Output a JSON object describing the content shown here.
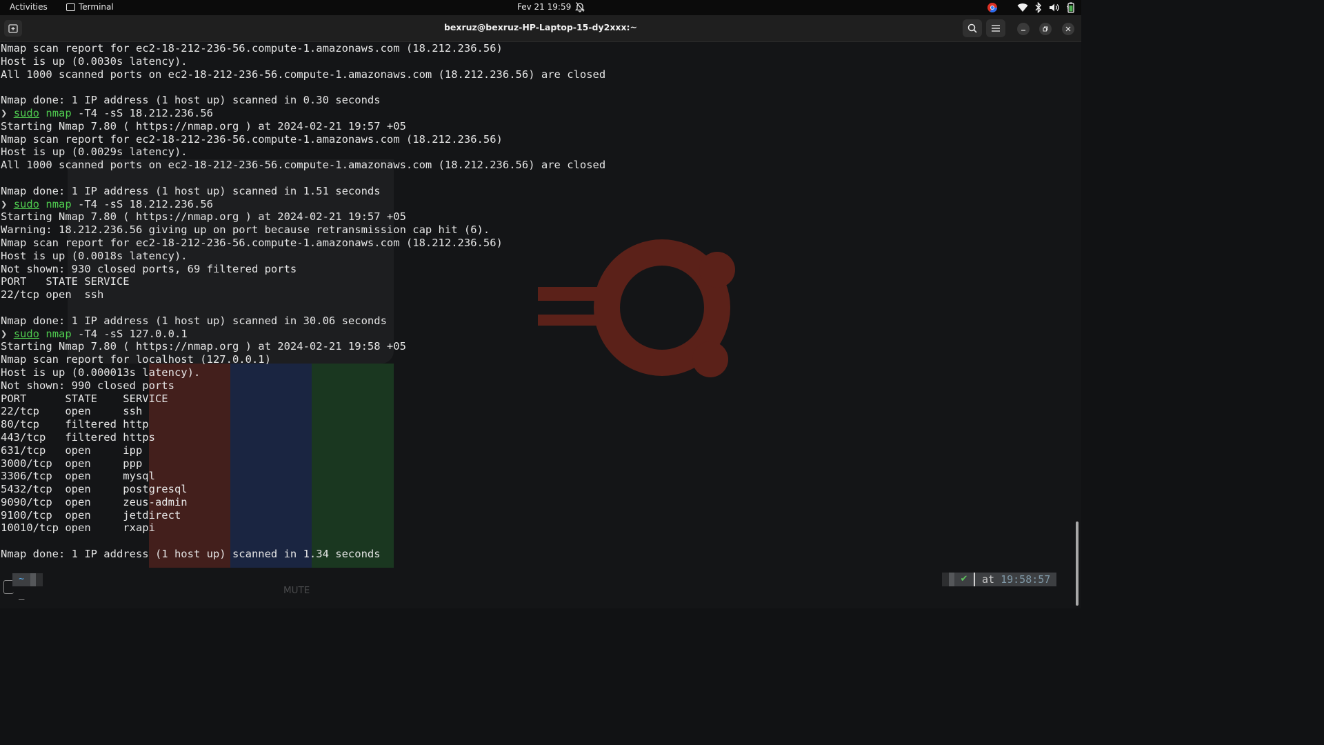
{
  "topbar": {
    "activities": "Activities",
    "app_name": "Terminal",
    "clock": "Fev 21  19:59",
    "tray_icons": [
      "chrome-icon",
      "wifi-icon",
      "bluetooth-icon",
      "volume-icon",
      "battery-icon"
    ]
  },
  "window": {
    "title": "bexruz@bexruz-HP-Laptop-15-dy2xxx:~"
  },
  "terminal": {
    "lines": [
      {
        "type": "out",
        "text": "Nmap scan report for ec2-18-212-236-56.compute-1.amazonaws.com (18.212.236.56)"
      },
      {
        "type": "out",
        "text": "Host is up (0.0030s latency)."
      },
      {
        "type": "out",
        "text": "All 1000 scanned ports on ec2-18-212-236-56.compute-1.amazonaws.com (18.212.236.56) are closed"
      },
      {
        "type": "out",
        "text": ""
      },
      {
        "type": "out",
        "text": "Nmap done: 1 IP address (1 host up) scanned in 0.30 seconds"
      },
      {
        "type": "cmd",
        "args": " -T4 -sS 18.212.236.56"
      },
      {
        "type": "out",
        "text": "Starting Nmap 7.80 ( https://nmap.org ) at 2024-02-21 19:57 +05"
      },
      {
        "type": "out",
        "text": "Nmap scan report for ec2-18-212-236-56.compute-1.amazonaws.com (18.212.236.56)"
      },
      {
        "type": "out",
        "text": "Host is up (0.0029s latency)."
      },
      {
        "type": "out",
        "text": "All 1000 scanned ports on ec2-18-212-236-56.compute-1.amazonaws.com (18.212.236.56) are closed"
      },
      {
        "type": "out",
        "text": ""
      },
      {
        "type": "out",
        "text": "Nmap done: 1 IP address (1 host up) scanned in 1.51 seconds"
      },
      {
        "type": "cmd",
        "args": " -T4 -sS 18.212.236.56"
      },
      {
        "type": "out",
        "text": "Starting Nmap 7.80 ( https://nmap.org ) at 2024-02-21 19:57 +05"
      },
      {
        "type": "out",
        "text": "Warning: 18.212.236.56 giving up on port because retransmission cap hit (6)."
      },
      {
        "type": "out",
        "text": "Nmap scan report for ec2-18-212-236-56.compute-1.amazonaws.com (18.212.236.56)"
      },
      {
        "type": "out",
        "text": "Host is up (0.0018s latency)."
      },
      {
        "type": "out",
        "text": "Not shown: 930 closed ports, 69 filtered ports"
      },
      {
        "type": "out",
        "text": "PORT   STATE SERVICE"
      },
      {
        "type": "out",
        "text": "22/tcp open  ssh"
      },
      {
        "type": "out",
        "text": ""
      },
      {
        "type": "out",
        "text": "Nmap done: 1 IP address (1 host up) scanned in 30.06 seconds"
      },
      {
        "type": "cmd",
        "args": " -T4 -sS 127.0.0.1"
      },
      {
        "type": "out",
        "text": "Starting Nmap 7.80 ( https://nmap.org ) at 2024-02-21 19:58 +05"
      },
      {
        "type": "out",
        "text": "Nmap scan report for localhost (127.0.0.1)"
      },
      {
        "type": "out",
        "text": "Host is up (0.000013s latency)."
      },
      {
        "type": "out",
        "text": "Not shown: 990 closed ports"
      },
      {
        "type": "out",
        "text": "PORT      STATE    SERVICE"
      },
      {
        "type": "out",
        "text": "22/tcp    open     ssh"
      },
      {
        "type": "out",
        "text": "80/tcp    filtered http"
      },
      {
        "type": "out",
        "text": "443/tcp   filtered https"
      },
      {
        "type": "out",
        "text": "631/tcp   open     ipp"
      },
      {
        "type": "out",
        "text": "3000/tcp  open     ppp"
      },
      {
        "type": "out",
        "text": "3306/tcp  open     mysql"
      },
      {
        "type": "out",
        "text": "5432/tcp  open     postgresql"
      },
      {
        "type": "out",
        "text": "9090/tcp  open     zeus-admin"
      },
      {
        "type": "out",
        "text": "9100/tcp  open     jetdirect"
      },
      {
        "type": "out",
        "text": "10010/tcp open     rxapi"
      },
      {
        "type": "out",
        "text": ""
      },
      {
        "type": "out",
        "text": "Nmap done: 1 IP address (1 host up) scanned in 1.34 seconds"
      }
    ],
    "prompt_arrow": "❯",
    "cmd_sudo": "sudo",
    "cmd_nmap": "nmap",
    "prompt_dir": "~",
    "cursor": "_",
    "status_check": "✔",
    "status_at": "at ",
    "status_time": "19:58:57",
    "ghost_mute": "MUTE"
  }
}
